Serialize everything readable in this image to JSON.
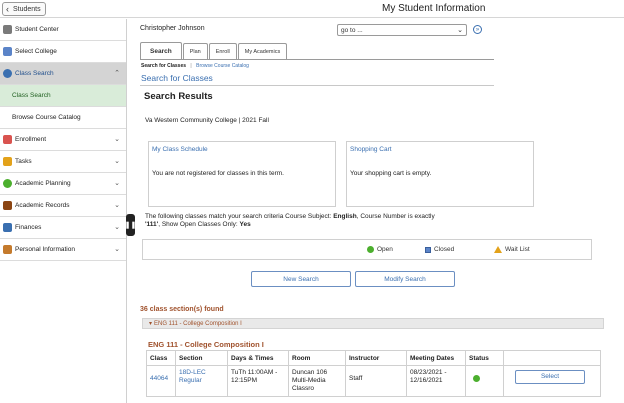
{
  "header": {
    "back_label": "Students",
    "title": "My Student Information"
  },
  "sidebar": {
    "items": [
      {
        "label": "Student Center",
        "icon": "student-center-icon",
        "color": "#7a7a7a"
      },
      {
        "label": "Select College",
        "icon": "select-college-icon",
        "color": "#5b84c8"
      },
      {
        "label": "Class Search",
        "icon": "class-search-icon",
        "color": "#3a6fb0"
      },
      {
        "label": "Class Search"
      },
      {
        "label": "Browse Course Catalog"
      },
      {
        "label": "Enrollment",
        "icon": "enrollment-icon",
        "color": "#d9534f"
      },
      {
        "label": "Tasks",
        "icon": "tasks-icon",
        "color": "#e3a21a"
      },
      {
        "label": "Academic Planning",
        "icon": "academic-planning-icon",
        "color": "#4caf2e"
      },
      {
        "label": "Academic Records",
        "icon": "academic-records-icon",
        "color": "#8b4513"
      },
      {
        "label": "Finances",
        "icon": "finances-icon",
        "color": "#3a6fb0"
      },
      {
        "label": "Personal Information",
        "icon": "personal-information-icon",
        "color": "#c47a2c"
      }
    ]
  },
  "main": {
    "student_name": "Christopher Johnson",
    "goto_value": "go to ...",
    "tabs": [
      {
        "label": "Search"
      },
      {
        "label": "Plan"
      },
      {
        "label": "Enroll"
      },
      {
        "label": "My Academics"
      }
    ],
    "breadcrumb": {
      "current": "Search for Classes",
      "separator": "|",
      "link": "Browse Course Catalog"
    },
    "subtitle": "Search for Classes",
    "results_title": "Search Results",
    "term": "Va Western Community College | 2021 Fall",
    "schedule_box": {
      "title": "My Class Schedule",
      "body": "You are not registered for classes in this term."
    },
    "cart_box": {
      "title": "Shopping Cart",
      "body": "Your shopping cart is empty."
    },
    "criteria": {
      "prefix": "The following classes match your search criteria Course Subject: ",
      "subject": "English",
      "mid": ",  Course Number is exactly",
      "number": "'111'",
      "open_label": ",  Show Open Classes Only: ",
      "open_value": "Yes"
    },
    "legend": {
      "open": "Open",
      "closed": "Closed",
      "waitlist": "Wait List"
    },
    "new_search": "New Search",
    "modify_search": "Modify Search",
    "found": "36 class section(s) found",
    "group_label": "ENG 111 - College Composition I",
    "course_title": "ENG 111 - College Composition I",
    "table": {
      "headers": [
        "Class",
        "Section",
        "Days & Times",
        "Room",
        "Instructor",
        "Meeting Dates",
        "Status",
        ""
      ],
      "row": {
        "class": "44064",
        "section_1": "18D-LEC",
        "section_2": "Regular",
        "days_1": "TuTh 11:00AM -",
        "days_2": "12:15PM",
        "room_1": "Duncan 106",
        "room_2": "Multi-Media",
        "room_3": "Classro",
        "instructor": "Staff",
        "dates_1": "08/23/2021 -",
        "dates_2": "12/16/2021",
        "status": "Open",
        "select": "Select"
      }
    }
  }
}
